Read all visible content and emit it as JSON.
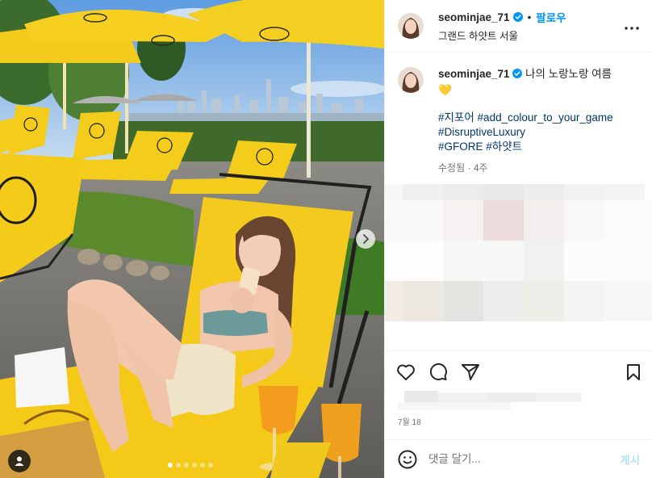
{
  "post": {
    "username": "seominjae_71",
    "follow_label": "팔로우",
    "separator": "•",
    "location": "그랜드 하얏트 서울",
    "caption_text": "나의 노랑노랑 여름",
    "caption_emoji": "💛",
    "hashtags": [
      {
        "text": "#지포어"
      },
      {
        "text": "#add_colour_to_your_game"
      },
      {
        "text": "#DisruptiveLuxury"
      },
      {
        "text": "#GFORE"
      },
      {
        "text": "#하얏트"
      }
    ],
    "meta_edited": "수정됨",
    "meta_sep": "·",
    "meta_age": "4주",
    "date": "7월 18"
  },
  "carousel": {
    "slides": 6,
    "active_index": 0
  },
  "comment": {
    "placeholder": "댓글 달기...",
    "post_label": "게시"
  },
  "icons": {
    "more": "more-horizontal-icon",
    "verified": "verified-badge-icon",
    "like": "heart-icon",
    "comment": "comment-icon",
    "share": "share-icon",
    "save": "bookmark-icon",
    "emoji": "emoji-icon",
    "next": "chevron-right-icon",
    "tagged": "user-tag-icon"
  },
  "colors": {
    "accent": "#0095f6",
    "link": "#00376b",
    "muted": "#737373",
    "umbrella": "#f6cf21",
    "post_disabled": "#b2dffc"
  }
}
